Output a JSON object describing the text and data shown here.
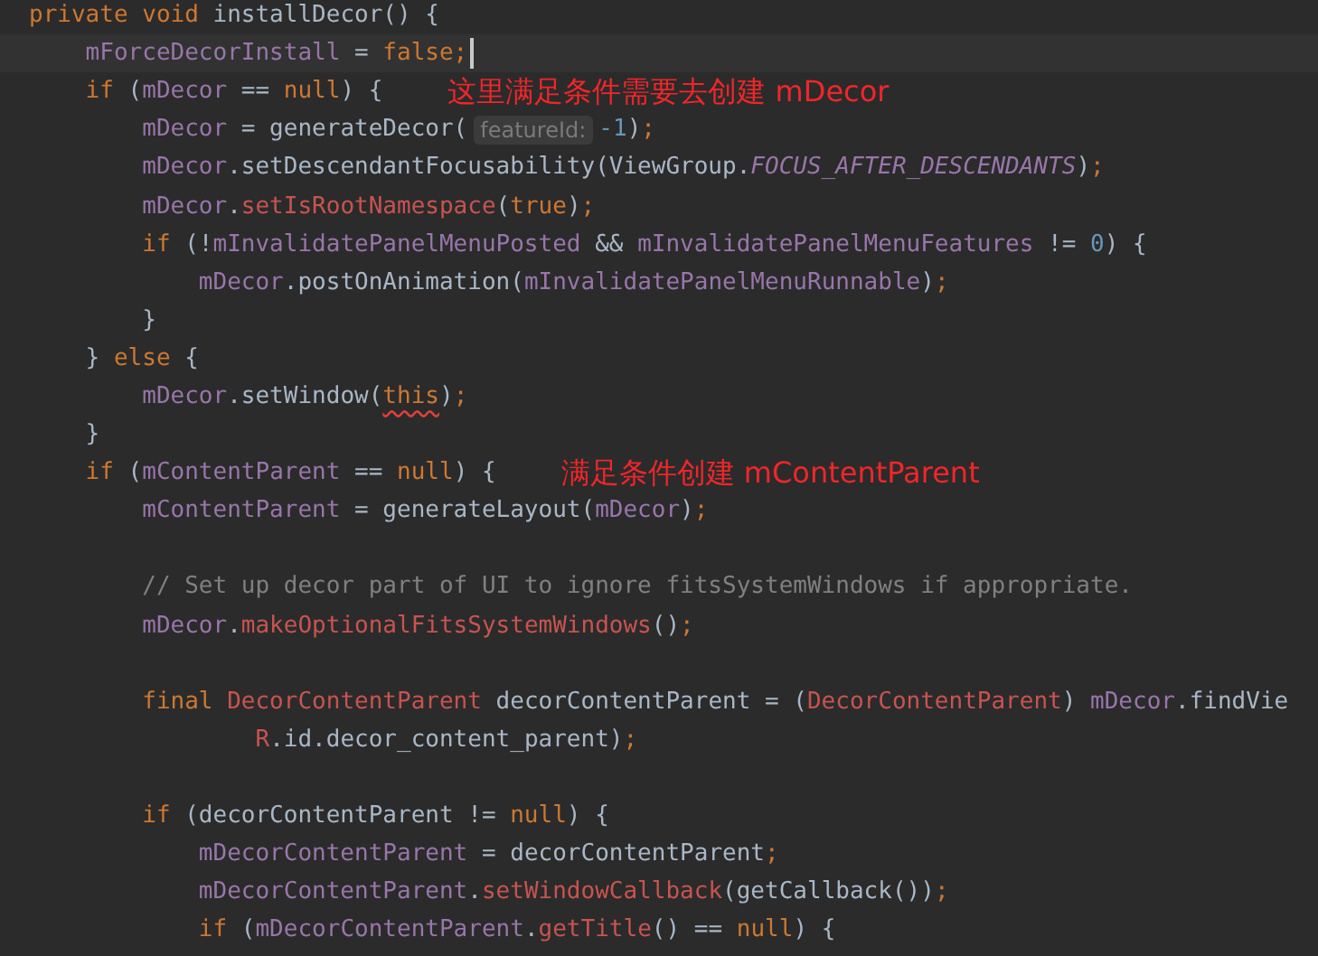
{
  "editor": {
    "lines": [
      {
        "current": false,
        "tokens": [
          {
            "text": "private void ",
            "kind": "keyword"
          },
          {
            "text": "installDecor() {",
            "kind": "plain"
          }
        ]
      },
      {
        "current": true,
        "tokens": [
          {
            "text": "    mForceDecorInstall",
            "kind": "field"
          },
          {
            "text": " = ",
            "kind": "plain"
          },
          {
            "text": "false;",
            "kind": "keyword"
          }
        ]
      },
      {
        "current": false,
        "tokens": [
          {
            "text": "    if ",
            "kind": "keyword"
          },
          {
            "text": "(",
            "kind": "plain"
          },
          {
            "text": "mDecor",
            "kind": "field"
          },
          {
            "text": " == ",
            "kind": "plain"
          },
          {
            "text": "null",
            "kind": "keyword"
          },
          {
            "text": ") {",
            "kind": "plain"
          }
        ],
        "note": "这里满足条件需要去创建 mDecor"
      },
      {
        "current": false,
        "tokens": [
          {
            "text": "        mDecor",
            "kind": "field"
          },
          {
            "text": " = generateDecor(",
            "kind": "plain"
          },
          {
            "text": "featureId:",
            "kind": "hint"
          },
          {
            "text": "-1",
            "kind": "number"
          },
          {
            "text": ")",
            "kind": "plain"
          },
          {
            "text": ";",
            "kind": "keyword"
          }
        ]
      },
      {
        "current": false,
        "tokens": [
          {
            "text": "        mDecor",
            "kind": "field"
          },
          {
            "text": ".setDescendantFocusability(ViewGroup.",
            "kind": "plain"
          },
          {
            "text": "FOCUS_AFTER_DESCENDANTS",
            "kind": "constant"
          },
          {
            "text": ")",
            "kind": "plain"
          },
          {
            "text": ";",
            "kind": "keyword"
          }
        ]
      },
      {
        "current": false,
        "tokens": [
          {
            "text": "        mDecor",
            "kind": "field"
          },
          {
            "text": ".",
            "kind": "plain"
          },
          {
            "text": "setIsRootNamespace",
            "kind": "call"
          },
          {
            "text": "(",
            "kind": "plain"
          },
          {
            "text": "true",
            "kind": "keyword"
          },
          {
            "text": ")",
            "kind": "plain"
          },
          {
            "text": ";",
            "kind": "keyword"
          }
        ]
      },
      {
        "current": false,
        "tokens": [
          {
            "text": "        if ",
            "kind": "keyword"
          },
          {
            "text": "(!",
            "kind": "plain"
          },
          {
            "text": "mInvalidatePanelMenuPosted",
            "kind": "field"
          },
          {
            "text": " && ",
            "kind": "plain"
          },
          {
            "text": "mInvalidatePanelMenuFeatures",
            "kind": "field"
          },
          {
            "text": " != ",
            "kind": "plain"
          },
          {
            "text": "0",
            "kind": "number"
          },
          {
            "text": ") {",
            "kind": "plain"
          }
        ]
      },
      {
        "current": false,
        "tokens": [
          {
            "text": "            mDecor",
            "kind": "field"
          },
          {
            "text": ".postOnAnimation(",
            "kind": "plain"
          },
          {
            "text": "mInvalidatePanelMenuRunnable",
            "kind": "field"
          },
          {
            "text": ")",
            "kind": "plain"
          },
          {
            "text": ";",
            "kind": "keyword"
          }
        ]
      },
      {
        "current": false,
        "tokens": [
          {
            "text": "        }",
            "kind": "plain"
          }
        ]
      },
      {
        "current": false,
        "tokens": [
          {
            "text": "    } ",
            "kind": "plain"
          },
          {
            "text": "else ",
            "kind": "keyword"
          },
          {
            "text": "{",
            "kind": "plain"
          }
        ]
      },
      {
        "current": false,
        "tokens": [
          {
            "text": "        mDecor",
            "kind": "field"
          },
          {
            "text": ".setWindow(",
            "kind": "plain"
          },
          {
            "text": "this",
            "kind": "error-keyword"
          },
          {
            "text": ")",
            "kind": "plain"
          },
          {
            "text": ";",
            "kind": "keyword"
          }
        ]
      },
      {
        "current": false,
        "tokens": [
          {
            "text": "    }",
            "kind": "plain"
          }
        ]
      },
      {
        "current": false,
        "tokens": [
          {
            "text": "    if ",
            "kind": "keyword"
          },
          {
            "text": "(",
            "kind": "plain"
          },
          {
            "text": "mContentParent",
            "kind": "field"
          },
          {
            "text": " == ",
            "kind": "plain"
          },
          {
            "text": "null",
            "kind": "keyword"
          },
          {
            "text": ") {",
            "kind": "plain"
          }
        ],
        "note": "满足条件创建 mContentParent"
      },
      {
        "current": false,
        "tokens": [
          {
            "text": "        mContentParent",
            "kind": "field"
          },
          {
            "text": " = generateLayout(",
            "kind": "plain"
          },
          {
            "text": "mDecor",
            "kind": "field"
          },
          {
            "text": ")",
            "kind": "plain"
          },
          {
            "text": ";",
            "kind": "keyword"
          }
        ]
      },
      {
        "current": false
      },
      {
        "current": false,
        "tokens": [
          {
            "text": "        // Set up decor part of UI to ignore fitsSystemWindows if appropriate.",
            "kind": "comment"
          }
        ]
      },
      {
        "current": false,
        "tokens": [
          {
            "text": "        mDecor",
            "kind": "field"
          },
          {
            "text": ".",
            "kind": "plain"
          },
          {
            "text": "makeOptionalFitsSystemWindows",
            "kind": "call"
          },
          {
            "text": "()",
            "kind": "plain"
          },
          {
            "text": ";",
            "kind": "keyword"
          }
        ]
      },
      {
        "current": false
      },
      {
        "current": false,
        "tokens": [
          {
            "text": "        final ",
            "kind": "keyword"
          },
          {
            "text": "DecorContentParent",
            "kind": "call"
          },
          {
            "text": " decorContentParent = (",
            "kind": "plain"
          },
          {
            "text": "DecorContentParent",
            "kind": "call"
          },
          {
            "text": ") ",
            "kind": "plain"
          },
          {
            "text": "mDecor",
            "kind": "field"
          },
          {
            "text": ".findVie",
            "kind": "plain"
          }
        ]
      },
      {
        "current": false,
        "tokens": [
          {
            "text": "                R",
            "kind": "call"
          },
          {
            "text": ".id.decor_content_parent)",
            "kind": "plain"
          },
          {
            "text": ";",
            "kind": "keyword"
          }
        ]
      },
      {
        "current": false
      },
      {
        "current": false,
        "tokens": [
          {
            "text": "        if ",
            "kind": "keyword"
          },
          {
            "text": "(decorContentParent != ",
            "kind": "plain"
          },
          {
            "text": "null",
            "kind": "keyword"
          },
          {
            "text": ") {",
            "kind": "plain"
          }
        ]
      },
      {
        "current": false,
        "tokens": [
          {
            "text": "            mDecorContentParent",
            "kind": "field"
          },
          {
            "text": " = decorContentParent",
            "kind": "plain"
          },
          {
            "text": ";",
            "kind": "keyword"
          }
        ]
      },
      {
        "current": false,
        "tokens": [
          {
            "text": "            mDecorContentParent",
            "kind": "field"
          },
          {
            "text": ".",
            "kind": "plain"
          },
          {
            "text": "setWindowCallback",
            "kind": "call"
          },
          {
            "text": "(getCallback())",
            "kind": "plain"
          },
          {
            "text": ";",
            "kind": "keyword"
          }
        ]
      },
      {
        "current": false,
        "tokens": [
          {
            "text": "            if ",
            "kind": "keyword"
          },
          {
            "text": "(",
            "kind": "plain"
          },
          {
            "text": "mDecorContentParent",
            "kind": "field"
          },
          {
            "text": ".",
            "kind": "plain"
          },
          {
            "text": "getTitle",
            "kind": "call"
          },
          {
            "text": "() == ",
            "kind": "plain"
          },
          {
            "text": "null",
            "kind": "keyword"
          },
          {
            "text": ") {",
            "kind": "plain"
          }
        ]
      }
    ]
  }
}
